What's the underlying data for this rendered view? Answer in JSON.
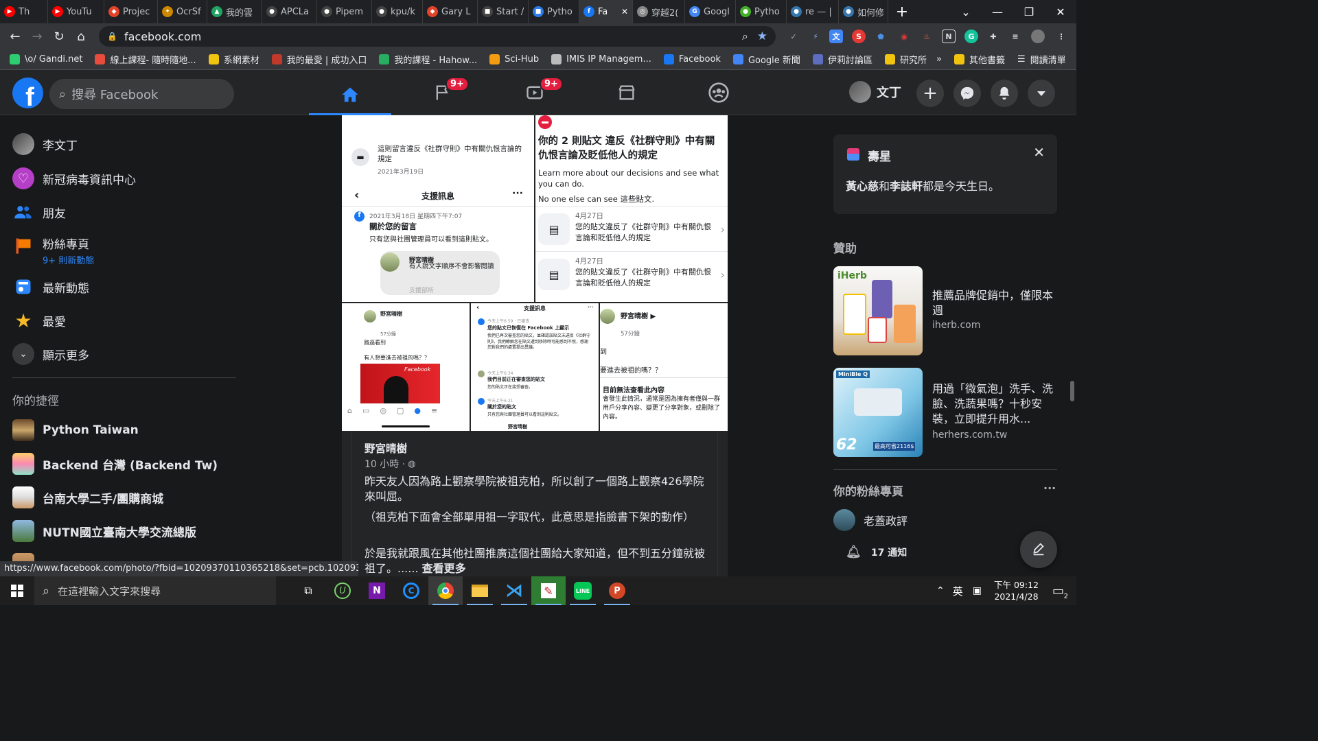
{
  "browser": {
    "tabs": [
      {
        "label": "Th",
        "color": "#ff0000",
        "glyph": "▶"
      },
      {
        "label": "YouTu",
        "color": "#ff0000",
        "glyph": "▶"
      },
      {
        "label": "Projec",
        "color": "#e24329",
        "glyph": "◆"
      },
      {
        "label": "OcrSf",
        "color": "#cc8800",
        "glyph": "✦"
      },
      {
        "label": "我的雲",
        "color": "#1fa463",
        "glyph": "▲"
      },
      {
        "label": "APCLa",
        "color": "#ffffff",
        "glyph": "●"
      },
      {
        "label": "Pipem",
        "color": "#ffffff",
        "glyph": "●"
      },
      {
        "label": "kpu/k",
        "color": "#ffffff",
        "glyph": "●"
      },
      {
        "label": "Gary L",
        "color": "#e24329",
        "glyph": "◆"
      },
      {
        "label": "Start /",
        "color": "#ffffff",
        "glyph": "■"
      },
      {
        "label": "Pytho",
        "color": "#2c7be5",
        "glyph": "■"
      },
      {
        "label": "Fa",
        "color": "#1877f2",
        "glyph": "f"
      },
      {
        "label": "穿越2(",
        "color": "#888888",
        "glyph": "◎"
      },
      {
        "label": "Googl",
        "color": "#4285f4",
        "glyph": "G"
      },
      {
        "label": "Pytho",
        "color": "#43b02a",
        "glyph": "●"
      },
      {
        "label": "re — |",
        "color": "#3776ab",
        "glyph": "●"
      },
      {
        "label": "如何修",
        "color": "#3776ab",
        "glyph": "●"
      }
    ],
    "url": "facebook.com",
    "bookmarks": [
      {
        "label": "\\o/ Gandi.net",
        "color": "#2ecc71"
      },
      {
        "label": "線上課程- 隨時隨地...",
        "color": "#e74c3c"
      },
      {
        "label": "系網素材",
        "color": "#f1c40f"
      },
      {
        "label": "我的最愛 | 成功入口",
        "color": "#c0392b"
      },
      {
        "label": "我的課程 - Hahow...",
        "color": "#27ae60"
      },
      {
        "label": "Sci-Hub",
        "color": "#f39c12"
      },
      {
        "label": "IMIS IP Managem...",
        "color": "#bbbbbb"
      },
      {
        "label": "Facebook",
        "color": "#1877f2"
      },
      {
        "label": "Google 新聞",
        "color": "#4285f4"
      },
      {
        "label": "伊莉討論區",
        "color": "#5d6dbf"
      },
      {
        "label": "研究所",
        "color": "#f1c40f"
      }
    ],
    "bookmarks_more": "»",
    "other_bookmarks": "其他書籤",
    "reading_list": "閱讀清單"
  },
  "header": {
    "search_placeholder": "搜尋 Facebook",
    "pages_badge": "9+",
    "watch_badge": "9+",
    "profile_name": "文丁"
  },
  "sidebar": {
    "items": [
      {
        "label": "李文丁"
      },
      {
        "label": "新冠病毒資訊中心"
      },
      {
        "label": "朋友"
      },
      {
        "label": "粉絲專頁",
        "sub": "9+ 則新動態"
      },
      {
        "label": "最新動態"
      },
      {
        "label": "最愛"
      },
      {
        "label": "顯示更多"
      }
    ],
    "shortcuts_title": "你的捷徑",
    "shortcuts": [
      {
        "label": "Python Taiwan"
      },
      {
        "label": "Backend 台灣 (Backend Tw)"
      },
      {
        "label": "台南大學二手/團購商城"
      },
      {
        "label": "NUTN國立臺南大學交流總版"
      }
    ]
  },
  "post": {
    "img1": {
      "notice": "這則留言違反《社群守則》中有關仇恨言論的規定",
      "notice_date": "2021年3月19日",
      "header": "支援訊息",
      "msg_date": "2021年3月18日 星期四下午7:07",
      "msg_title": "關於您的留言",
      "msg_body": "只有您與社團管理員可以看到這則貼文。",
      "commenter": "野宮晴樹",
      "comment": "有人說文字順序不會影響閱讀",
      "tail": "支援部所"
    },
    "img2": {
      "title": "你的 2 則貼文 違反《社群守則》中有關仇恨言論及貶低他人的規定",
      "learn": "Learn more about our decisions and see what you can do.",
      "no_one": "No one else can see 這些貼文.",
      "rows": [
        {
          "date": "4月27日",
          "text": "您的貼文違反了《社群守則》中有關仇恨言論和貶低他人的規定"
        },
        {
          "date": "4月27日",
          "text": "您的貼文違反了《社群守則》中有關仇恨言論和貶低他人的規定"
        }
      ]
    },
    "img3": {
      "name": "野宮晴樹",
      "time": "57分鐘",
      "line1": "路過看到",
      "line2": "有人想要進去被祖的嗎？？",
      "brand": "Facebook"
    },
    "img4": {
      "header": "支援訊息",
      "t1": "今天上午6:59 · 已審查",
      "m1": "您的貼文已恢復在 Facebook 上顯示",
      "b1": "我們已再次審查您的貼文，並確認該貼文未違反《社群守則》。我們瞭解您在貼文遭到移除時可能感到不悅，感謝您對我們的處置提出異議。",
      "t2": "今天上午6:34",
      "m2": "我們目前正在審查您的貼文",
      "b2": "您的貼文正在接受審查。",
      "t3": "今天上午6:31",
      "m3": "關於您的貼文",
      "b3": "只有您與社團管理員可以看到這則貼文。",
      "foot": "野宮晴樹"
    },
    "img5": {
      "name": "野宮晴樹 ▶",
      "time": "57分鐘",
      "line0": "到",
      "line1": "要進去被祖的嗎？？",
      "title": "目前無法查看此內容",
      "body": "會發生此情況，通常是因為擁有者僅與一群用戶分享內容、變更了分享對象，或刪除了內容。"
    },
    "author": "野宮晴樹",
    "time": "10 小時 ·",
    "text1": "昨天友人因為路上觀察學院被祖克柏，所以創了一個路上觀察426學院來叫屈。",
    "text2": "（祖克柏下面會全部單用祖一字取代，此意思是指臉書下架的動作）",
    "text3": "於是我就跟風在其他社團推廣這個社團給大家知道，但不到五分鐘就被祖了。......",
    "see_more": "查看更多"
  },
  "right": {
    "birthday_title": "壽星",
    "birthday_name1": "黃心慈",
    "birthday_and": "和",
    "birthday_name2": "李誌軒",
    "birthday_tail": "都是今天生日。",
    "sponsored_title": "贊助",
    "ads": [
      {
        "text": "推薦品牌促銷中，僅限本週",
        "domain": "iherb.com",
        "brand": "iHerb"
      },
      {
        "text": "用過「微氣泡」洗手、洗臉、洗蔬果嗎？十秒安裝，立即提升用水...",
        "domain": "herhers.com.tw",
        "brand": "MiniBle Q",
        "price": "62",
        "price2": "最高可省2116$"
      }
    ],
    "pages_title": "你的粉絲專頁",
    "pages_more": "···",
    "page_name": "老蓋政評",
    "notif": "17 通知"
  },
  "status_url": "https://www.facebook.com/photo/?fbid=10209370110365218&set=pcb.10209370124...",
  "taskbar": {
    "search_placeholder": "在這裡輸入文字來搜尋",
    "ime": "英",
    "time": "下午 09:12",
    "date": "2021/4/28",
    "notif_count": "2"
  }
}
